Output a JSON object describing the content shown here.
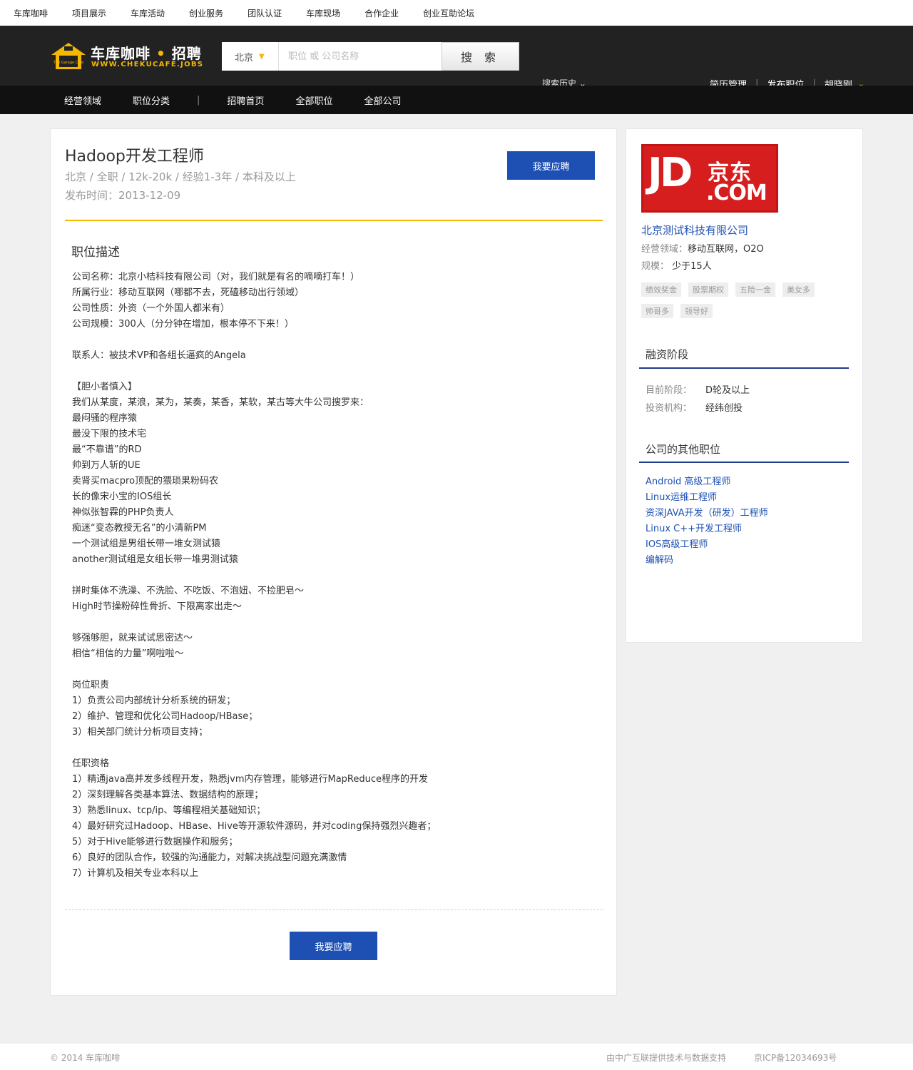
{
  "topbar": {
    "links": [
      "车库咖啡",
      "项目展示",
      "车库活动",
      "创业服务",
      "团队认证",
      "车库现场",
      "合作企业",
      "创业互助论坛"
    ]
  },
  "header": {
    "logo_text": "车库咖啡",
    "logo_dot": "•",
    "logo_text2": "招聘",
    "logo_sub": "WWW.CHEKUCAFE.JOBS",
    "logo_house": "The Garage Cafe",
    "city": "北京",
    "search_placeholder": "职位 或 公司名称",
    "search_button": "搜 索",
    "history": "搜索历史",
    "resume": "简历管理",
    "post_job": "发布职位",
    "user": "胡晓刚"
  },
  "nav": {
    "items": [
      "经营领域",
      "职位分类",
      "招聘首页",
      "全部职位",
      "全部公司"
    ],
    "separator": "|"
  },
  "job": {
    "title": "Hadoop开发工程师",
    "meta": "北京 / 全职 / 12k-20k / 经验1-3年 / 本科及以上",
    "date": "发布时间：2013-12-09",
    "apply": "我要应聘",
    "desc_heading": "职位描述",
    "description": "公司名称：北京小桔科技有限公司（对，我们就是有名的嘀嘀打车！）\n所属行业：移动互联网（哪都不去，死磕移动出行领域）\n公司性质：外资（一个外国人都米有）\n公司规模：300人（分分钟在增加，根本停不下来！）\n\n联系人：被技术VP和各组长逼疯的Angela\n\n【胆小者慎入】\n我们从某度，某浪，某为，某奏，某香，某软，某古等大牛公司搜罗来：\n最闷骚的程序猿\n最没下限的技术宅\n最“不靠谱”的RD\n帅到万人斩的UE\n卖肾买macpro顶配的猥琐果粉码农\n长的像宋小宝的IOS组长\n神似张智霖的PHP负责人\n痴迷“变态教授无名”的小清新PM\n一个测试组是男组长带一堆女测试猿\nanother测试组是女组长带一堆男测试猿\n\n拼时集体不洗澡、不洗脸、不吃饭、不泡妞、不捡肥皂～\nHigh时节操粉碎性骨折、下限离家出走～\n\n够强够胆，就来试试思密达～\n相信“相信的力量”啊啦啦～\n\n岗位职责\n1）负责公司内部统计分析系统的研发；\n2）维护、管理和优化公司Hadoop/HBase；\n3）相关部门统计分析项目支持；\n\n任职资格\n1）精通java高并发多线程开发，熟悉jvm内存管理，能够进行MapReduce程序的开发\n2）深刻理解各类基本算法、数据结构的原理；\n3）熟悉linux、tcp/ip、等编程相关基础知识；\n4）最好研究过Hadoop、HBase、Hive等开源软件源码，并对coding保持强烈兴趣者；\n5）对于Hive能够进行数据操作和服务；\n6）良好的团队合作，较强的沟通能力，对解决挑战型问题充满激情\n7）计算机及相关专业本科以上",
    "apply_bottom": "我要应聘"
  },
  "company": {
    "logo_jd": "JD",
    "logo_cn": "京东",
    "logo_com": ".COM",
    "name": "北京测试科技有限公司",
    "field_label": "经营领域：",
    "field_value": "移动互联网，O2O",
    "scale_label": "规模：",
    "scale_value": "少于15人",
    "tags": [
      "绩效奖金",
      "股票期权",
      "五险一金",
      "美女多",
      "帅哥多",
      "领导好"
    ],
    "funding_heading": "融资阶段",
    "stage_label": "目前阶段：",
    "stage_value": "D轮及以上",
    "investor_label": "投资机构：",
    "investor_value": "经纬创投",
    "other_heading": "公司的其他职位",
    "other_jobs": [
      "Android 高级工程师",
      "Linux运维工程师",
      "资深JAVA开发（研发）工程师",
      "Linux C++开发工程师",
      "IOS高级工程师",
      "编解码"
    ]
  },
  "footer": {
    "copyright": "© 2014 车库咖啡",
    "support": "由中广互联提供技术与数据支持",
    "icp": "京ICP备12034693号"
  },
  "colors": {
    "accent_gold": "#f5b800",
    "button_blue": "#1e50b4",
    "header_dark": "#222222",
    "jd_red": "#d71e1e"
  },
  "icons": {
    "city_caret": "chevron-down-icon",
    "user_caret": "chevron-down-icon",
    "history_caret": "chevron-down-icon"
  }
}
